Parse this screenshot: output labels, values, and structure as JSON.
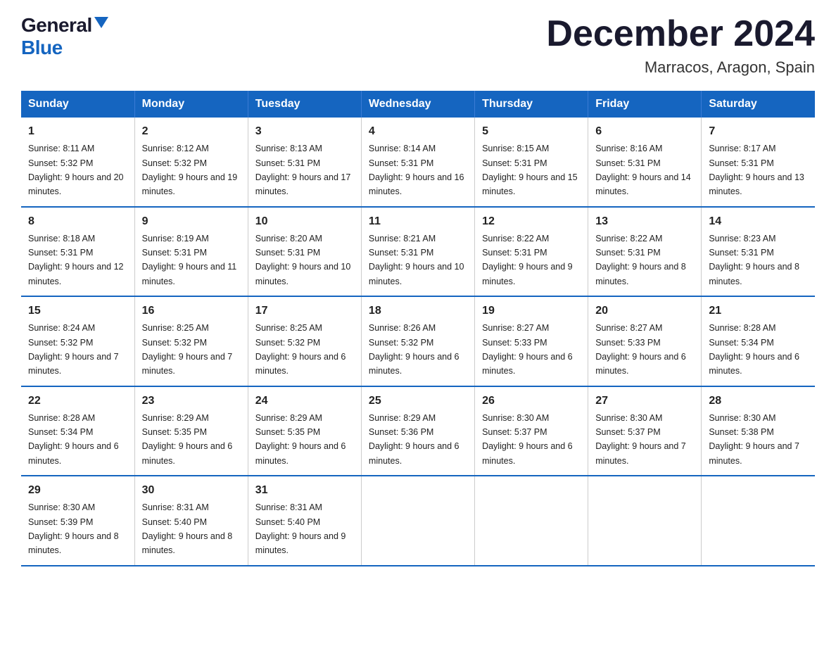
{
  "logo": {
    "general": "General",
    "blue": "Blue"
  },
  "title": "December 2024",
  "subtitle": "Marracos, Aragon, Spain",
  "headers": [
    "Sunday",
    "Monday",
    "Tuesday",
    "Wednesday",
    "Thursday",
    "Friday",
    "Saturday"
  ],
  "weeks": [
    [
      {
        "day": "1",
        "sunrise": "8:11 AM",
        "sunset": "5:32 PM",
        "daylight": "9 hours and 20 minutes."
      },
      {
        "day": "2",
        "sunrise": "8:12 AM",
        "sunset": "5:32 PM",
        "daylight": "9 hours and 19 minutes."
      },
      {
        "day": "3",
        "sunrise": "8:13 AM",
        "sunset": "5:31 PM",
        "daylight": "9 hours and 17 minutes."
      },
      {
        "day": "4",
        "sunrise": "8:14 AM",
        "sunset": "5:31 PM",
        "daylight": "9 hours and 16 minutes."
      },
      {
        "day": "5",
        "sunrise": "8:15 AM",
        "sunset": "5:31 PM",
        "daylight": "9 hours and 15 minutes."
      },
      {
        "day": "6",
        "sunrise": "8:16 AM",
        "sunset": "5:31 PM",
        "daylight": "9 hours and 14 minutes."
      },
      {
        "day": "7",
        "sunrise": "8:17 AM",
        "sunset": "5:31 PM",
        "daylight": "9 hours and 13 minutes."
      }
    ],
    [
      {
        "day": "8",
        "sunrise": "8:18 AM",
        "sunset": "5:31 PM",
        "daylight": "9 hours and 12 minutes."
      },
      {
        "day": "9",
        "sunrise": "8:19 AM",
        "sunset": "5:31 PM",
        "daylight": "9 hours and 11 minutes."
      },
      {
        "day": "10",
        "sunrise": "8:20 AM",
        "sunset": "5:31 PM",
        "daylight": "9 hours and 10 minutes."
      },
      {
        "day": "11",
        "sunrise": "8:21 AM",
        "sunset": "5:31 PM",
        "daylight": "9 hours and 10 minutes."
      },
      {
        "day": "12",
        "sunrise": "8:22 AM",
        "sunset": "5:31 PM",
        "daylight": "9 hours and 9 minutes."
      },
      {
        "day": "13",
        "sunrise": "8:22 AM",
        "sunset": "5:31 PM",
        "daylight": "9 hours and 8 minutes."
      },
      {
        "day": "14",
        "sunrise": "8:23 AM",
        "sunset": "5:31 PM",
        "daylight": "9 hours and 8 minutes."
      }
    ],
    [
      {
        "day": "15",
        "sunrise": "8:24 AM",
        "sunset": "5:32 PM",
        "daylight": "9 hours and 7 minutes."
      },
      {
        "day": "16",
        "sunrise": "8:25 AM",
        "sunset": "5:32 PM",
        "daylight": "9 hours and 7 minutes."
      },
      {
        "day": "17",
        "sunrise": "8:25 AM",
        "sunset": "5:32 PM",
        "daylight": "9 hours and 6 minutes."
      },
      {
        "day": "18",
        "sunrise": "8:26 AM",
        "sunset": "5:32 PM",
        "daylight": "9 hours and 6 minutes."
      },
      {
        "day": "19",
        "sunrise": "8:27 AM",
        "sunset": "5:33 PM",
        "daylight": "9 hours and 6 minutes."
      },
      {
        "day": "20",
        "sunrise": "8:27 AM",
        "sunset": "5:33 PM",
        "daylight": "9 hours and 6 minutes."
      },
      {
        "day": "21",
        "sunrise": "8:28 AM",
        "sunset": "5:34 PM",
        "daylight": "9 hours and 6 minutes."
      }
    ],
    [
      {
        "day": "22",
        "sunrise": "8:28 AM",
        "sunset": "5:34 PM",
        "daylight": "9 hours and 6 minutes."
      },
      {
        "day": "23",
        "sunrise": "8:29 AM",
        "sunset": "5:35 PM",
        "daylight": "9 hours and 6 minutes."
      },
      {
        "day": "24",
        "sunrise": "8:29 AM",
        "sunset": "5:35 PM",
        "daylight": "9 hours and 6 minutes."
      },
      {
        "day": "25",
        "sunrise": "8:29 AM",
        "sunset": "5:36 PM",
        "daylight": "9 hours and 6 minutes."
      },
      {
        "day": "26",
        "sunrise": "8:30 AM",
        "sunset": "5:37 PM",
        "daylight": "9 hours and 6 minutes."
      },
      {
        "day": "27",
        "sunrise": "8:30 AM",
        "sunset": "5:37 PM",
        "daylight": "9 hours and 7 minutes."
      },
      {
        "day": "28",
        "sunrise": "8:30 AM",
        "sunset": "5:38 PM",
        "daylight": "9 hours and 7 minutes."
      }
    ],
    [
      {
        "day": "29",
        "sunrise": "8:30 AM",
        "sunset": "5:39 PM",
        "daylight": "9 hours and 8 minutes."
      },
      {
        "day": "30",
        "sunrise": "8:31 AM",
        "sunset": "5:40 PM",
        "daylight": "9 hours and 8 minutes."
      },
      {
        "day": "31",
        "sunrise": "8:31 AM",
        "sunset": "5:40 PM",
        "daylight": "9 hours and 9 minutes."
      },
      null,
      null,
      null,
      null
    ]
  ]
}
